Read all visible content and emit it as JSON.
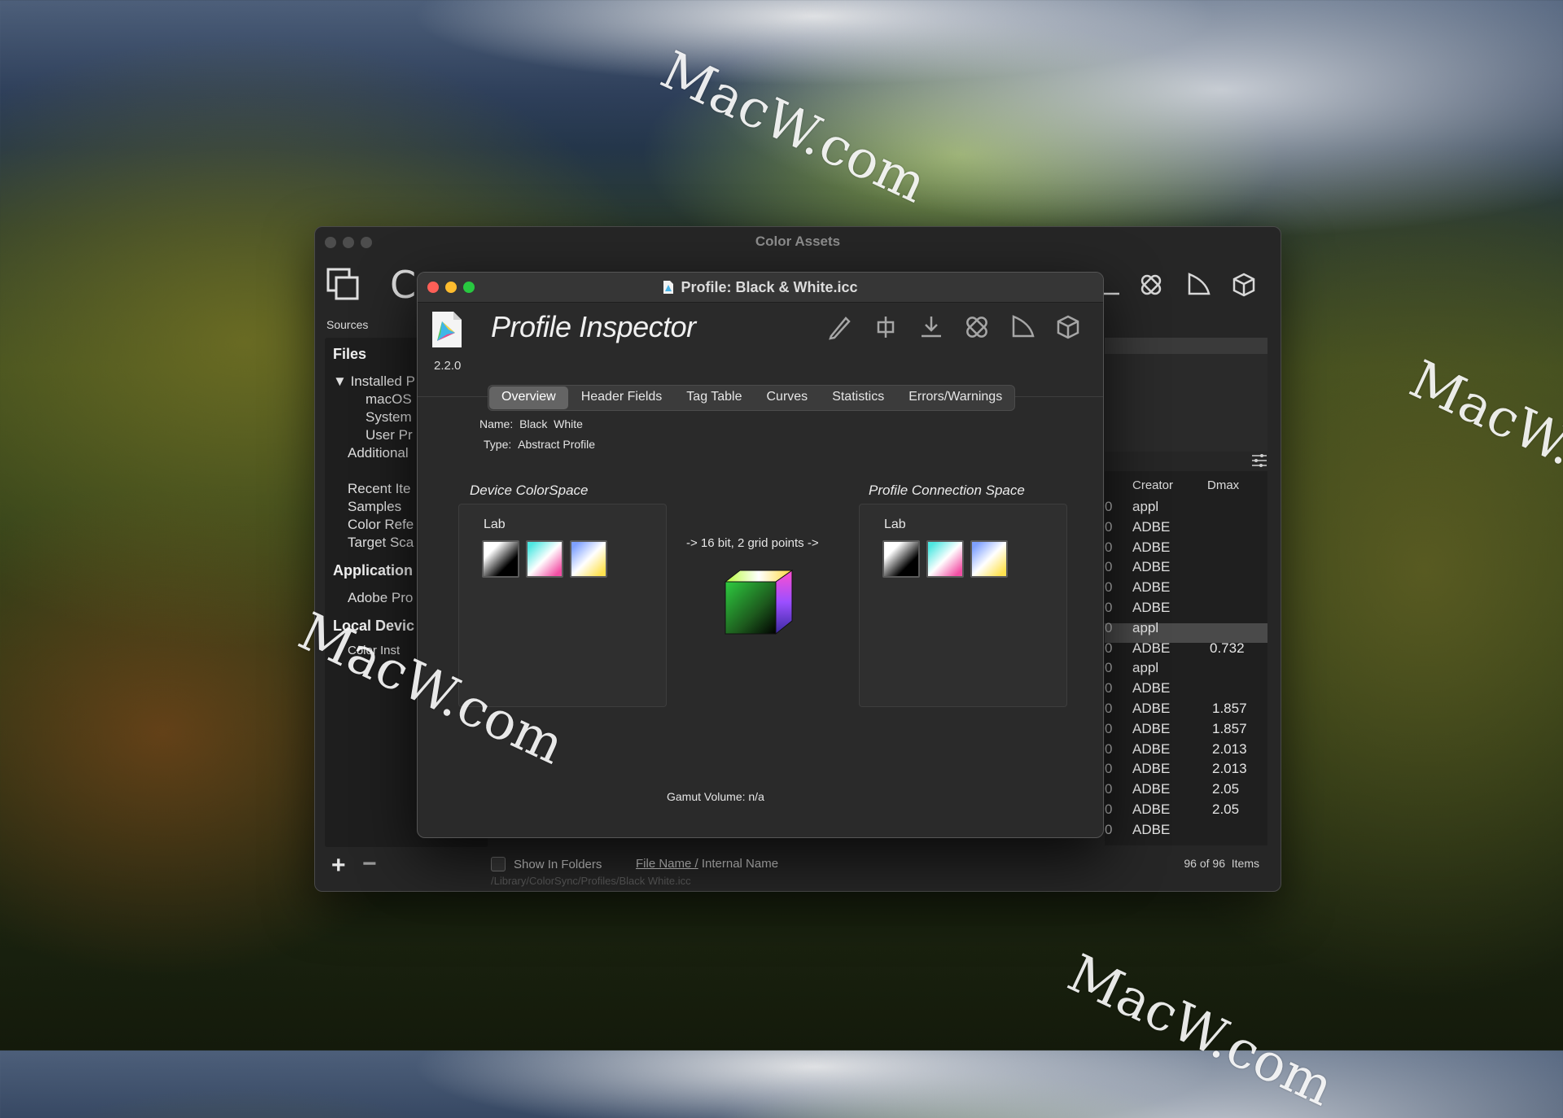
{
  "watermark": "MacW.com",
  "back_window": {
    "title": "Color Assets",
    "toolbar_letter": "C",
    "sources_label": "Sources",
    "sidebar": {
      "files_header": "Files",
      "installed": "Installed P",
      "macos": "macOS",
      "system": "System",
      "user": "User Pr",
      "additional": "Additional",
      "recent": "Recent Ite",
      "samples": "Samples",
      "color_ref": "Color Refe",
      "target": "Target Sca",
      "applications_header": "Application",
      "adobe": "Adobe Pro",
      "local_devices_header": "Local Devic",
      "color_inst": "Color Inst"
    },
    "columns": {
      "creator": "Creator",
      "dmax": "Dmax"
    },
    "rows": [
      {
        "creator": "appl",
        "dmax": ""
      },
      {
        "creator": "ADBE",
        "dmax": ""
      },
      {
        "creator": "ADBE",
        "dmax": ""
      },
      {
        "creator": "ADBE",
        "dmax": ""
      },
      {
        "creator": "ADBE",
        "dmax": ""
      },
      {
        "creator": "ADBE",
        "dmax": ""
      },
      {
        "creator": "appl",
        "dmax": ""
      },
      {
        "creator": "ADBE",
        "dmax": "0.732"
      },
      {
        "creator": "appl",
        "dmax": ""
      },
      {
        "creator": "ADBE",
        "dmax": ""
      },
      {
        "creator": "ADBE",
        "dmax": "1.857"
      },
      {
        "creator": "ADBE",
        "dmax": "1.857"
      },
      {
        "creator": "ADBE",
        "dmax": "2.013"
      },
      {
        "creator": "ADBE",
        "dmax": "2.013"
      },
      {
        "creator": "ADBE",
        "dmax": "2.05"
      },
      {
        "creator": "ADBE",
        "dmax": "2.05"
      },
      {
        "creator": "ADBE",
        "dmax": ""
      }
    ],
    "show_in_folders": "Show In Folders",
    "file_name": "File Name /",
    "internal_name": "Internal Name",
    "path": "/Library/ColorSync/Profiles/Black  White.icc",
    "count": "96 of 96",
    "items": "Items",
    "add": "+",
    "remove": "−"
  },
  "front_window": {
    "title": "Profile: Black & White.icc",
    "app_title": "Profile Inspector",
    "version": "2.2.0",
    "tabs": [
      "Overview",
      "Header Fields",
      "Tag Table",
      "Curves",
      "Statistics",
      "Errors/Warnings"
    ],
    "active_tab": "Overview",
    "name_label": "Name:",
    "name_value": "Black  White",
    "type_label": "Type:",
    "type_value": "Abstract Profile",
    "device_cs_title": "Device ColorSpace",
    "device_cs_label": "Lab",
    "pcs_title": "Profile Connection Space",
    "pcs_label": "Lab",
    "conversion": "-> 16 bit, 2 grid points ->",
    "gamut_label": "Gamut Volume:",
    "gamut_value": "n/a"
  },
  "icons": [
    "pencil-icon",
    "split-icon",
    "download-icon",
    "bandage-icon",
    "gamut-icon",
    "cube-icon"
  ]
}
